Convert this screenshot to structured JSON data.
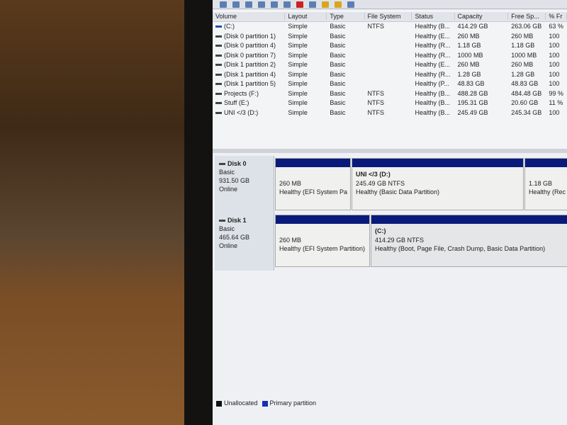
{
  "volume_list": {
    "columns": [
      "Volume",
      "Layout",
      "Type",
      "File System",
      "Status",
      "Capacity",
      "Free Sp...",
      "% Fr"
    ],
    "rows": [
      [
        "(C:)",
        "Simple",
        "Basic",
        "NTFS",
        "Healthy (B...",
        "414.29 GB",
        "263.06 GB",
        "63 %"
      ],
      [
        "(Disk 0 partition 1)",
        "Simple",
        "Basic",
        "",
        "Healthy (E...",
        "260 MB",
        "260 MB",
        "100"
      ],
      [
        "(Disk 0 partition 4)",
        "Simple",
        "Basic",
        "",
        "Healthy (R...",
        "1.18 GB",
        "1.18 GB",
        "100"
      ],
      [
        "(Disk 0 partition 7)",
        "Simple",
        "Basic",
        "",
        "Healthy (R...",
        "1000 MB",
        "1000 MB",
        "100"
      ],
      [
        "(Disk 1 partition 2)",
        "Simple",
        "Basic",
        "",
        "Healthy (E...",
        "260 MB",
        "260 MB",
        "100"
      ],
      [
        "(Disk 1 partition 4)",
        "Simple",
        "Basic",
        "",
        "Healthy (R...",
        "1.28 GB",
        "1.28 GB",
        "100"
      ],
      [
        "(Disk 1 partition 5)",
        "Simple",
        "Basic",
        "",
        "Healthy (P...",
        "48.83 GB",
        "48.83 GB",
        "100"
      ],
      [
        "Projects (F:)",
        "Simple",
        "Basic",
        "NTFS",
        "Healthy (B...",
        "488.28 GB",
        "484.48 GB",
        "99 %"
      ],
      [
        "Stuff (E:)",
        "Simple",
        "Basic",
        "NTFS",
        "Healthy (B...",
        "195.31 GB",
        "20.60 GB",
        "11 %"
      ],
      [
        "UNI </3 (D:)",
        "Simple",
        "Basic",
        "NTFS",
        "Healthy (B...",
        "245.49 GB",
        "245.34 GB",
        "100"
      ]
    ]
  },
  "disks": [
    {
      "name": "Disk 0",
      "type": "Basic",
      "size": "931.50 GB",
      "state": "Online",
      "partitions": [
        {
          "title": "",
          "size": "260 MB",
          "status": "Healthy (EFI System Pa"
        },
        {
          "title": "UNI </3  (D:)",
          "size": "245.49 GB NTFS",
          "status": "Healthy (Basic Data Partition)"
        },
        {
          "title": "",
          "size": "1.18 GB",
          "status": "Healthy (Rec"
        }
      ]
    },
    {
      "name": "Disk 1",
      "type": "Basic",
      "size": "465.64 GB",
      "state": "Online",
      "partitions": [
        {
          "title": "",
          "size": "260 MB",
          "status": "Healthy (EFI System Partition)"
        },
        {
          "title": "(C:)",
          "size": "414.29 GB NTFS",
          "status": "Healthy (Boot, Page File, Crash Dump, Basic Data Partition)"
        }
      ]
    }
  ],
  "legend": {
    "unallocated": "Unallocated",
    "primary": "Primary partition",
    "unallocated_color": "#111111",
    "primary_color": "#1a2fb0"
  }
}
